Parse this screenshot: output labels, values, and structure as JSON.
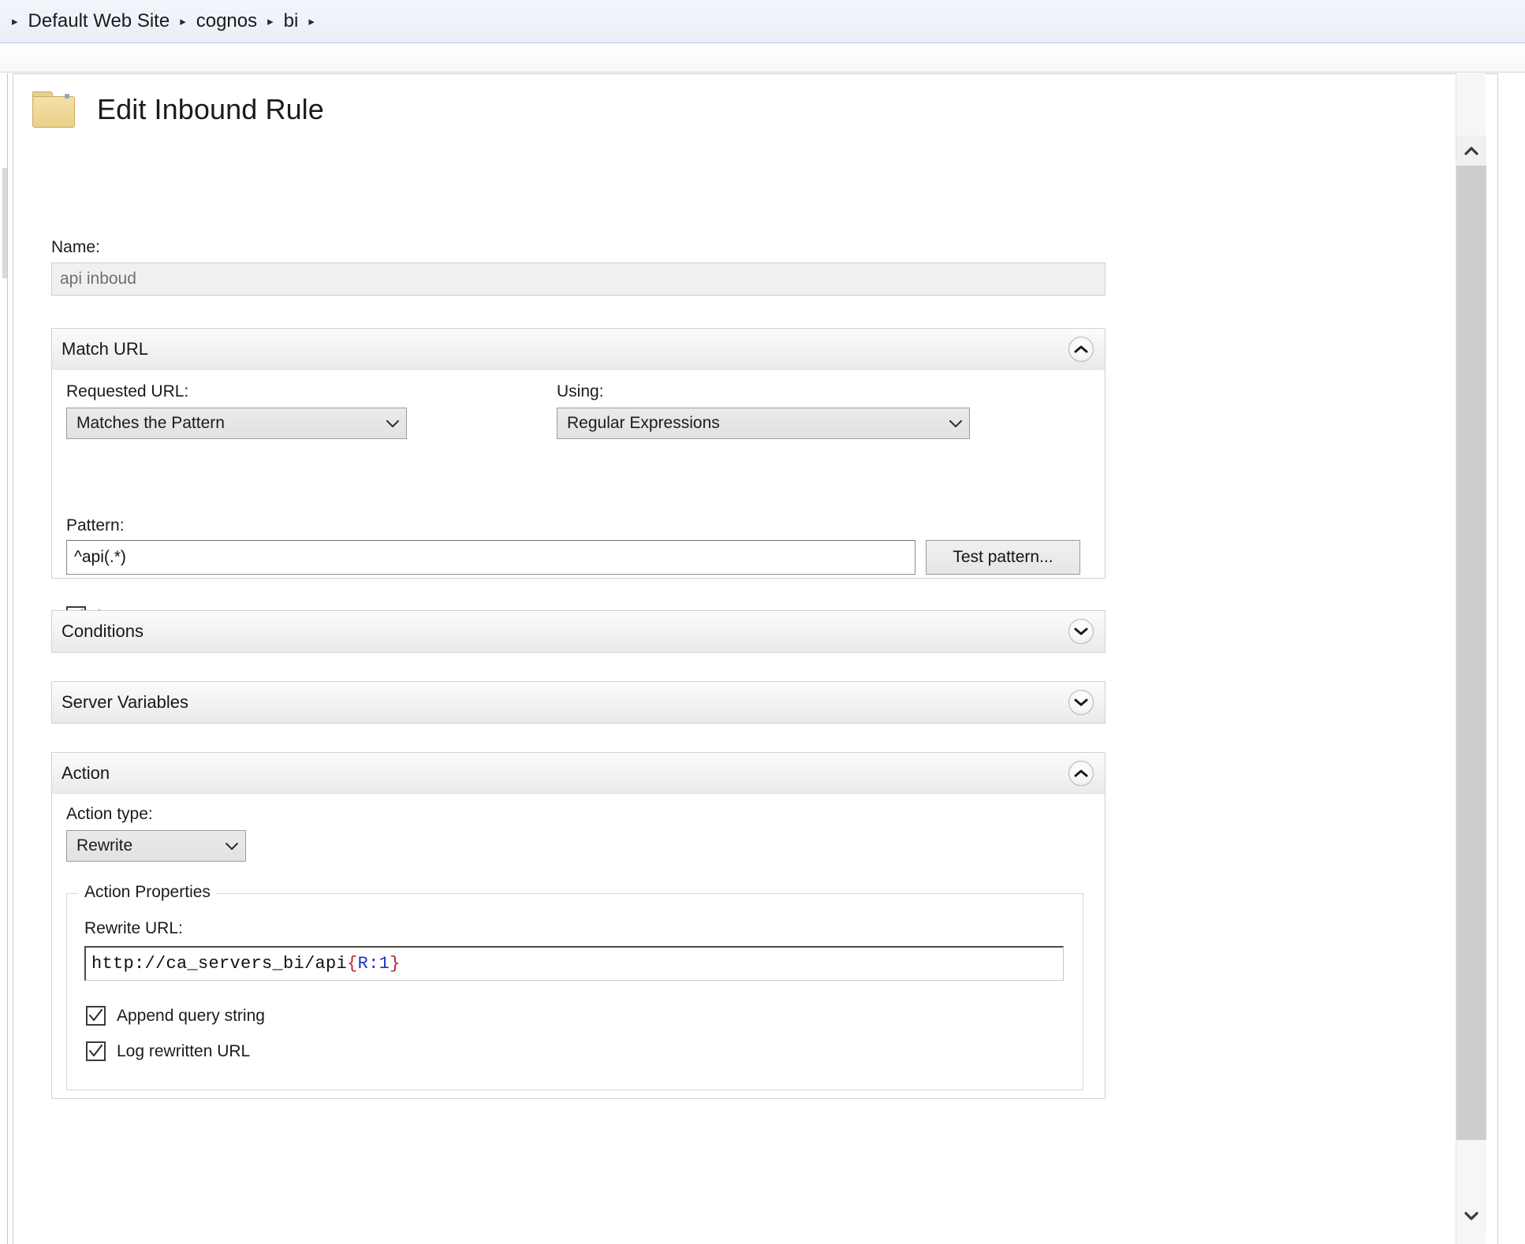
{
  "breadcrumb": {
    "items": [
      "Default Web Site",
      "cognos",
      "bi"
    ],
    "separator_icon": "triangle-right-icon"
  },
  "page": {
    "title": "Edit Inbound Rule",
    "icon": "folder-icon"
  },
  "name_field": {
    "label": "Name:",
    "value": "api inboud",
    "disabled": true
  },
  "match_url": {
    "title": "Match URL",
    "expanded": true,
    "toggle_icon": "chevron-up-icon",
    "requested_url": {
      "label": "Requested URL:",
      "value": "Matches the Pattern",
      "arrow_icon": "chevron-down-icon"
    },
    "using": {
      "label": "Using:",
      "value": "Regular Expressions",
      "arrow_icon": "chevron-down-icon"
    },
    "pattern": {
      "label": "Pattern:",
      "value": "^api(.*)"
    },
    "test_pattern_button": "Test pattern...",
    "ignore_case": {
      "label": "Ignore case",
      "checked": true,
      "icon": "checkmark-icon"
    }
  },
  "conditions": {
    "title": "Conditions",
    "expanded": false,
    "toggle_icon": "chevron-down-icon"
  },
  "server_variables": {
    "title": "Server Variables",
    "expanded": false,
    "toggle_icon": "chevron-down-icon"
  },
  "action": {
    "title": "Action",
    "expanded": true,
    "toggle_icon": "chevron-up-icon",
    "action_type": {
      "label": "Action type:",
      "value": "Rewrite",
      "arrow_icon": "chevron-down-icon"
    },
    "properties": {
      "legend": "Action Properties",
      "rewrite_url": {
        "label": "Rewrite URL:",
        "value_plain": "http://ca_servers_bi/api",
        "value_brace_open": "{",
        "value_variable": "R:1",
        "value_brace_close": "}"
      },
      "append_query_string": {
        "label": "Append query string",
        "checked": true,
        "icon": "checkmark-icon"
      },
      "log_rewritten_url": {
        "label": "Log rewritten URL",
        "checked": true,
        "icon": "checkmark-icon"
      }
    }
  },
  "scrollbar": {
    "up_icon": "chevron-up-icon",
    "down_icon": "chevron-down-icon"
  },
  "colors": {
    "brace": "#c0222b",
    "variable": "#1f31c8",
    "folder": "#ecd08a",
    "breadcrumb_bg": "#eef3fa"
  }
}
